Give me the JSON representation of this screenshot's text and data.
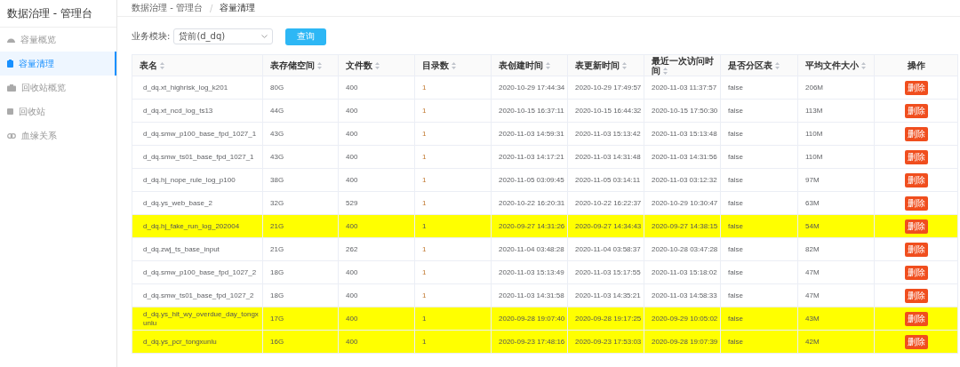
{
  "sidebar": {
    "title": "数据治理 - 管理台",
    "items": [
      {
        "label": "容量概览",
        "selected": false
      },
      {
        "label": "容量清理",
        "selected": true
      },
      {
        "label": "回收站概览",
        "selected": false
      },
      {
        "label": "回收站",
        "selected": false
      },
      {
        "label": "血缘关系",
        "selected": false
      }
    ]
  },
  "breadcrumb": {
    "items": [
      "数据治理 - 管理台",
      "容量清理"
    ],
    "separator": "/"
  },
  "filter": {
    "label": "业务模块:",
    "value": "贷前(d_dq)",
    "button": "查询"
  },
  "table": {
    "columns": [
      {
        "label": "表名",
        "sortable": true
      },
      {
        "label": "表存储空间",
        "sortable": true
      },
      {
        "label": "文件数",
        "sortable": true
      },
      {
        "label": "目录数",
        "sortable": true
      },
      {
        "label": "表创建时间",
        "sortable": true
      },
      {
        "label": "表更新时间",
        "sortable": true
      },
      {
        "label": "最近一次访问时间",
        "sortable": true
      },
      {
        "label": "是否分区表",
        "sortable": true
      },
      {
        "label": "平均文件大小",
        "sortable": true
      },
      {
        "label": "操作",
        "sortable": false
      }
    ],
    "rows": [
      {
        "highlighted": false,
        "action": "删除",
        "cells": [
          "d_dq.xt_highrisk_log_k201",
          "80G",
          "400",
          "1",
          "2020-10-29 17:44:34",
          "2020-10-29 17:49:57",
          "2020-11-03 11:37:57",
          "false",
          "206M"
        ]
      },
      {
        "highlighted": false,
        "action": "删除",
        "cells": [
          "d_dq.xt_ncd_log_ts13",
          "44G",
          "400",
          "1",
          "2020-10-15 16:37:11",
          "2020-10-15 16:44:32",
          "2020-10-15 17:50:30",
          "false",
          "113M"
        ]
      },
      {
        "highlighted": false,
        "action": "删除",
        "cells": [
          "d_dq.smw_p100_base_fpd_1027_1",
          "43G",
          "400",
          "1",
          "2020-11-03 14:59:31",
          "2020-11-03 15:13:42",
          "2020-11-03 15:13:48",
          "false",
          "110M"
        ]
      },
      {
        "highlighted": false,
        "action": "删除",
        "cells": [
          "d_dq.smw_ts01_base_fpd_1027_1",
          "43G",
          "400",
          "1",
          "2020-11-03 14:17:21",
          "2020-11-03 14:31:48",
          "2020-11-03 14:31:56",
          "false",
          "110M"
        ]
      },
      {
        "highlighted": false,
        "action": "删除",
        "cells": [
          "d_dq.hj_nope_rule_log_p100",
          "38G",
          "400",
          "1",
          "2020-11-05 03:09:45",
          "2020-11-05 03:14:11",
          "2020-11-03 03:12:32",
          "false",
          "97M"
        ]
      },
      {
        "highlighted": false,
        "action": "删除",
        "cells": [
          "d_dq.ys_web_base_2",
          "32G",
          "529",
          "1",
          "2020-10-22 16:20:31",
          "2020-10-22 16:22:37",
          "2020-10-29 10:30:47",
          "false",
          "63M"
        ]
      },
      {
        "highlighted": true,
        "action": "删除",
        "cells": [
          "d_dq.hj_fake_run_log_202004",
          "21G",
          "400",
          "1",
          "2020-09-27 14:31:26",
          "2020-09-27 14:34:43",
          "2020-09-27 14:38:15",
          "false",
          "54M"
        ]
      },
      {
        "highlighted": false,
        "action": "删除",
        "cells": [
          "d_dq.zwj_ts_base_input",
          "21G",
          "262",
          "1",
          "2020-11-04 03:48:28",
          "2020-11-04 03:58:37",
          "2020-10-28 03:47:28",
          "false",
          "82M"
        ]
      },
      {
        "highlighted": false,
        "action": "删除",
        "cells": [
          "d_dq.smw_p100_base_fpd_1027_2",
          "18G",
          "400",
          "1",
          "2020-11-03 15:13:49",
          "2020-11-03 15:17:55",
          "2020-11-03 15:18:02",
          "false",
          "47M"
        ]
      },
      {
        "highlighted": false,
        "action": "删除",
        "cells": [
          "d_dq.smw_ts01_base_fpd_1027_2",
          "18G",
          "400",
          "1",
          "2020-11-03 14:31:58",
          "2020-11-03 14:35:21",
          "2020-11-03 14:58:33",
          "false",
          "47M"
        ]
      },
      {
        "highlighted": true,
        "action": "删除",
        "cells": [
          "d_dq.ys_hit_wy_overdue_day_tongxunlu",
          "17G",
          "400",
          "1",
          "2020-09-28 19:07:40",
          "2020-09-28 19:17:25",
          "2020-09-29 10:05:02",
          "false",
          "43M"
        ]
      },
      {
        "highlighted": true,
        "action": "删除",
        "cells": [
          "d_dq.ys_pcr_tongxunlu",
          "16G",
          "400",
          "1",
          "2020-09-23 17:48:16",
          "2020-09-23 17:53:03",
          "2020-09-28 19:07:39",
          "false",
          "42M"
        ]
      }
    ]
  }
}
